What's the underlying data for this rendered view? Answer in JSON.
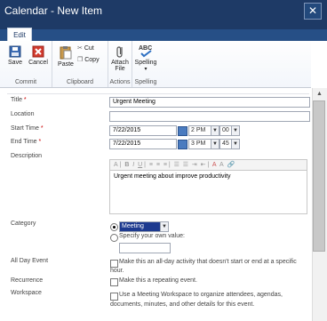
{
  "window": {
    "title": "Calendar - New Item",
    "close_glyph": "✕"
  },
  "ribbon": {
    "tab": "Edit",
    "commit": {
      "save": "Save",
      "cancel": "Cancel",
      "label": "Commit"
    },
    "clipboard": {
      "paste": "Paste",
      "cut": "Cut",
      "copy": "Copy",
      "label": "Clipboard"
    },
    "actions": {
      "attach": "Attach",
      "attach2": "File",
      "label": "Actions"
    },
    "spelling": {
      "spelling": "Spelling",
      "label": "Spelling",
      "abc": "ABC"
    }
  },
  "form": {
    "title": {
      "label": "Title",
      "value": "Urgent Meeting"
    },
    "location": {
      "label": "Location",
      "value": ""
    },
    "start": {
      "label": "Start Time",
      "date": "7/22/2015",
      "hour": "2 PM",
      "min": "00"
    },
    "end": {
      "label": "End Time",
      "date": "7/22/2015",
      "hour": "3 PM",
      "min": "45"
    },
    "description": {
      "label": "Description",
      "value": "Urgent meeting about improve productivity"
    },
    "category": {
      "label": "Category",
      "selected": "Meeting",
      "own_value_label": "Specify your own value:"
    },
    "all_day": {
      "label": "All Day Event",
      "text1": "Make this an all-day activity that doesn't start or end at a specific",
      "text2": "hour."
    },
    "recurrence": {
      "label": "Recurrence",
      "text": "Make this a repeating event."
    },
    "workspace": {
      "label": "Workspace",
      "text1": "Use a Meeting Workspace to organize attendees, agendas,",
      "text2": "documents, minutes, and other details for this event."
    }
  },
  "required_mark": "*"
}
